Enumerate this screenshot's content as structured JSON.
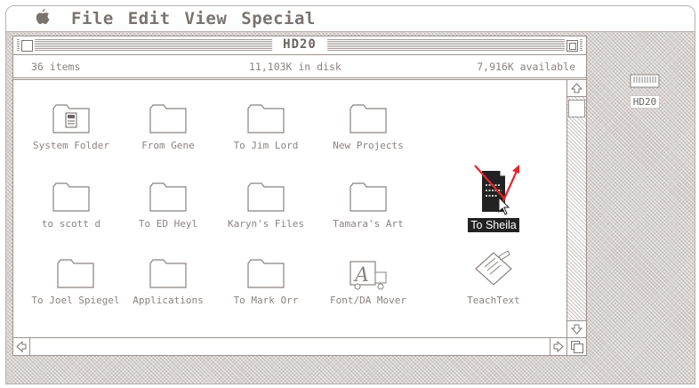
{
  "menubar": {
    "apple_icon": "apple-icon",
    "items": [
      "File",
      "Edit",
      "View",
      "Special"
    ]
  },
  "window": {
    "title": "HD20",
    "info": {
      "items": "36 items",
      "in_disk": "11,103K in disk",
      "available": "7,916K available"
    }
  },
  "icons": [
    {
      "label": "System Folder",
      "kind": "system-folder"
    },
    {
      "label": "From Gene",
      "kind": "folder"
    },
    {
      "label": "To Jim Lord",
      "kind": "folder"
    },
    {
      "label": "New Projects",
      "kind": "folder"
    },
    {
      "label": "to scott d",
      "kind": "folder"
    },
    {
      "label": "To ED Heyl",
      "kind": "folder"
    },
    {
      "label": "Karyn's Files",
      "kind": "folder"
    },
    {
      "label": "Tamara's Art",
      "kind": "folder"
    },
    {
      "label": "To Sheila",
      "kind": "document",
      "selected": true
    },
    {
      "label": "To Joel Spiegel",
      "kind": "folder"
    },
    {
      "label": "Applications",
      "kind": "folder"
    },
    {
      "label": "To Mark Orr",
      "kind": "folder"
    },
    {
      "label": "Font/DA Mover",
      "kind": "application"
    },
    {
      "label": "TeachText",
      "kind": "application"
    }
  ],
  "desktop": {
    "disk_label": "HD20"
  },
  "colors": {
    "annotation_arrow": "#e8242e",
    "selection": "#222222"
  }
}
